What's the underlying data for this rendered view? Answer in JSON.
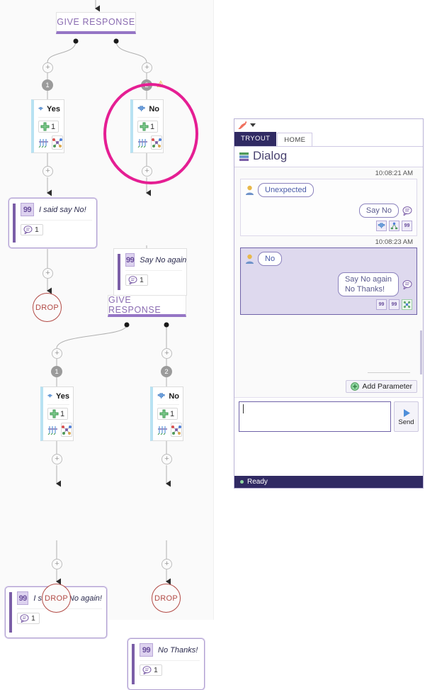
{
  "diagram": {
    "nodes": {
      "give_response_1": "GIVE RESPONSE",
      "give_response_2": "GIVE RESPONSE",
      "intent_yes_top": "Yes",
      "intent_no_top": "No",
      "intent_yes_bottom": "Yes",
      "intent_no_bottom": "No",
      "resp_i_said_say_no": "I said say No!",
      "resp_say_no_again": "Say No again",
      "resp_i_said_say_no_again": "I said say No again!",
      "resp_no_thanks": "No Thanks!",
      "drop_1": "DROP",
      "drop_2": "DROP",
      "drop_3": "DROP"
    },
    "badges": {
      "one": "1",
      "two": "2",
      "counts": {
        "sample_count": "1",
        "response_count": "1"
      }
    },
    "icons": {
      "plus_node": "+",
      "quote": "99",
      "warning": "⚠",
      "add_sample": "+"
    },
    "annotation": {
      "highlight_color": "#e51e93",
      "shape": "ellipse"
    },
    "colors": {
      "give_response_accent": "#9575c5",
      "intent_accent": "#b8e2f2",
      "response_accent": "#7b5ea7",
      "drop_color": "#b24a45"
    }
  },
  "chat": {
    "logo": "flamingo-icon",
    "tabs": [
      {
        "label": "TRYOUT",
        "active": true
      },
      {
        "label": "HOME",
        "active": false
      }
    ],
    "title": "Dialog",
    "messages": [
      {
        "timestamp": "10:08:21 AM",
        "selected": false,
        "user_text": "Unexpected",
        "bot_text": "Say No",
        "icons": [
          "intent-icon",
          "entity-icon",
          "quote-icon"
        ]
      },
      {
        "timestamp": "10:08:23 AM",
        "selected": true,
        "user_text": "No",
        "bot_text": "Say No again\nNo Thanks!",
        "icons": [
          "quote-icon",
          "quote-icon",
          "node-icon"
        ]
      }
    ],
    "add_parameter": "Add Parameter",
    "input": {
      "value": "",
      "placeholder": ""
    },
    "send_label": "Send",
    "status": "Ready",
    "colors": {
      "header": "#302a63",
      "selection": "#ded9ee",
      "status_dot": "#8fd6a0"
    }
  }
}
